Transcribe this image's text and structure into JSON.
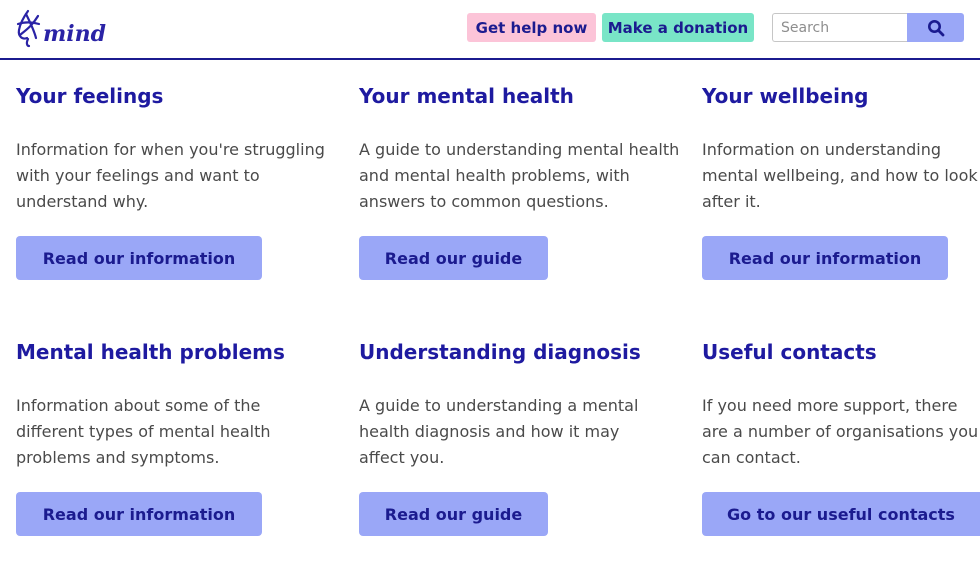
{
  "header": {
    "logo_text": "mind",
    "get_help_label": "Get help now",
    "donate_label": "Make a donation",
    "search_placeholder": "Search"
  },
  "cards": [
    {
      "title": "Your feelings",
      "description": "Information for when you're struggling with your feelings and want to understand why.",
      "button_label": "Read our information"
    },
    {
      "title": "Your mental health",
      "description": "A guide to understanding mental health and mental health problems, with answers to common questions.",
      "button_label": "Read our guide"
    },
    {
      "title": "Your wellbeing",
      "description": "Information on understanding mental wellbeing, and how to look after it.",
      "button_label": "Read our information"
    },
    {
      "title": "Mental health problems",
      "description": "Information about some of the different types of mental health problems and symptoms.",
      "button_label": "Read our information"
    },
    {
      "title": "Understanding diagnosis",
      "description": "A guide to understanding a mental health diagnosis and how it may affect you.",
      "button_label": "Read our guide"
    },
    {
      "title": "Useful contacts",
      "description": "If you need more support, there are a number of organisations you can contact.",
      "button_label": "Go to our useful contacts"
    }
  ],
  "colors": {
    "brand": "#1e1aa0",
    "button_bg": "#9aa7f7",
    "help_pill": "#fcc4d8",
    "donate_pill": "#79e5c7"
  },
  "icons": {
    "logo": "mind-logo-icon",
    "search": "search-icon"
  }
}
